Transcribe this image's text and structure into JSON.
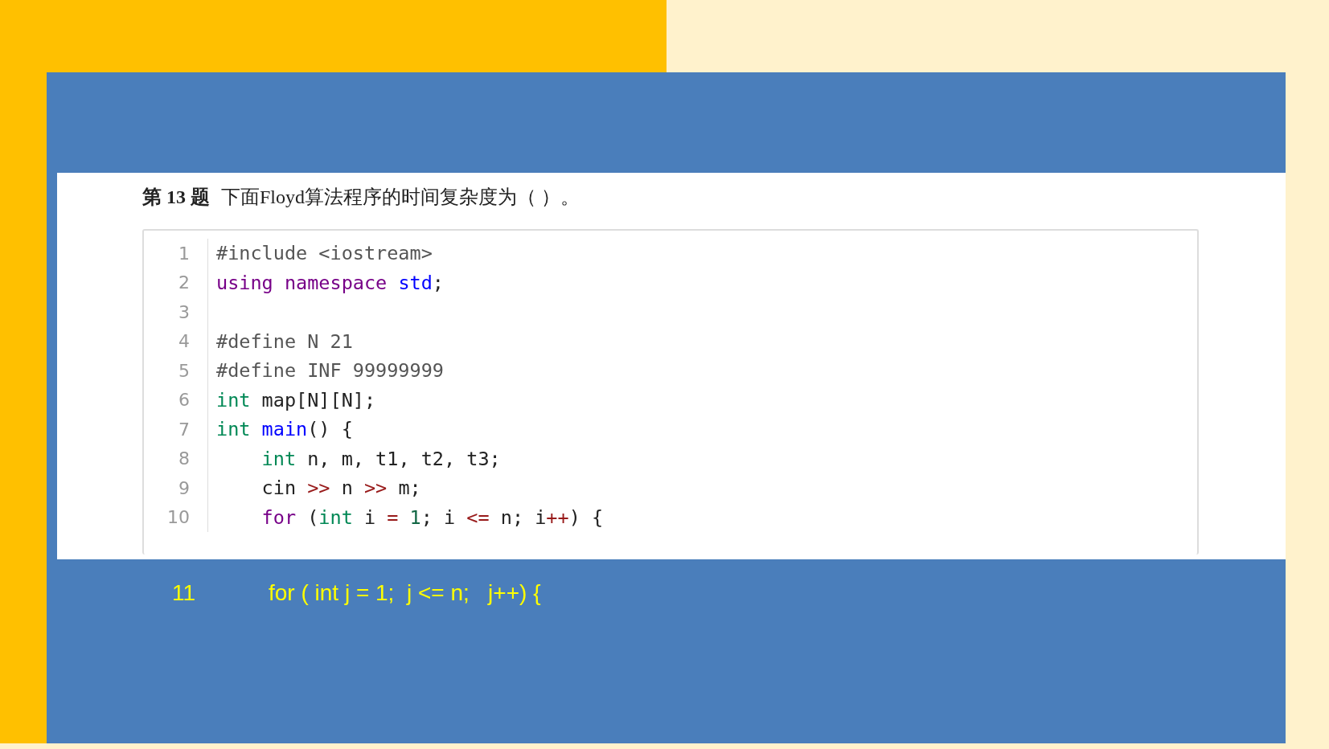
{
  "question": {
    "number": "第 13 题",
    "text": "下面Floyd算法程序的时间复杂度为（ ）。"
  },
  "code_lines": [
    {
      "number": "1",
      "tokens": [
        {
          "kind": "meta",
          "text": "#include <iostream>"
        }
      ]
    },
    {
      "number": "2",
      "tokens": [
        {
          "kind": "keyword",
          "text": "using namespace "
        },
        {
          "kind": "def",
          "text": "std"
        },
        {
          "kind": "plain",
          "text": ";"
        }
      ]
    },
    {
      "number": "3"
    },
    {
      "number": "4",
      "tokens": [
        {
          "kind": "meta",
          "text": "#define N 21"
        }
      ]
    },
    {
      "number": "5",
      "tokens": [
        {
          "kind": "meta",
          "text": "#define INF 99999999"
        }
      ]
    },
    {
      "number": "6",
      "tokens": [
        {
          "kind": "type",
          "text": "int"
        },
        {
          "kind": "plain",
          "text": " map[N][N];"
        }
      ]
    },
    {
      "number": "7",
      "tokens": [
        {
          "kind": "type",
          "text": "int "
        },
        {
          "kind": "def",
          "text": "main"
        },
        {
          "kind": "plain",
          "text": "() {"
        }
      ]
    },
    {
      "number": "8",
      "tokens": [
        {
          "kind": "type",
          "text": "    int"
        },
        {
          "kind": "plain",
          "text": " n, m, t1, t2, t3;"
        }
      ]
    },
    {
      "number": "9",
      "tokens": [
        {
          "kind": "plain",
          "text": "    cin "
        },
        {
          "kind": "operator",
          "text": ">>"
        },
        {
          "kind": "plain",
          "text": " n "
        },
        {
          "kind": "operator",
          "text": ">>"
        },
        {
          "kind": "plain",
          "text": " m;"
        }
      ]
    },
    {
      "number": "10",
      "tokens": [
        {
          "kind": "keyword",
          "text": "    for"
        },
        {
          "kind": "plain",
          "text": " ("
        },
        {
          "kind": "type",
          "text": "int"
        },
        {
          "kind": "plain",
          "text": " i "
        },
        {
          "kind": "operator",
          "text": "= "
        },
        {
          "kind": "number",
          "text": "1"
        },
        {
          "kind": "plain",
          "text": "; i "
        },
        {
          "kind": "operator",
          "text": "<="
        },
        {
          "kind": "plain",
          "text": " n; i"
        },
        {
          "kind": "operator",
          "text": "++"
        },
        {
          "kind": "plain",
          "text": ") {"
        }
      ]
    }
  ],
  "highlight_line": {
    "number": "11",
    "text": "for ( int j = 1;  j <= n;   j++) {"
  }
}
